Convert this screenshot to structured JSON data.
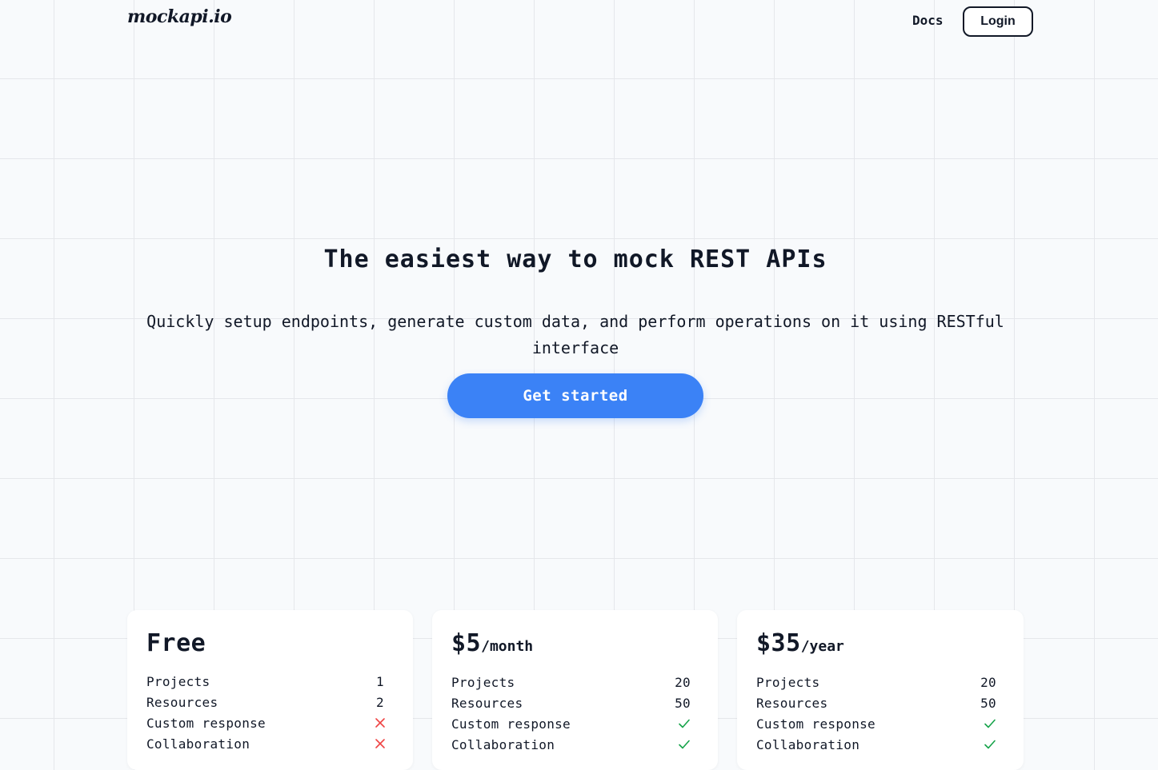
{
  "header": {
    "logo": "mockapi.io",
    "nav": {
      "docs_label": "Docs",
      "login_label": "Login"
    }
  },
  "hero": {
    "title": "The easiest way to mock REST APIs",
    "subtitle": "Quickly setup endpoints, generate custom data, and perform operations on it using RESTful interface",
    "cta_label": "Get started"
  },
  "pricing": {
    "plans": [
      {
        "price": "Free",
        "period": "",
        "features": [
          {
            "label": "Projects",
            "value": "1"
          },
          {
            "label": "Resources",
            "value": "2"
          },
          {
            "label": "Custom response",
            "icon": "x-icon"
          },
          {
            "label": "Collaboration",
            "icon": "x-icon"
          }
        ]
      },
      {
        "price": "$5",
        "period": "/month",
        "features": [
          {
            "label": "Projects",
            "value": "20"
          },
          {
            "label": "Resources",
            "value": "50"
          },
          {
            "label": "Custom response",
            "icon": "check-icon"
          },
          {
            "label": "Collaboration",
            "icon": "check-icon"
          }
        ]
      },
      {
        "price": "$35",
        "period": "/year",
        "features": [
          {
            "label": "Projects",
            "value": "20"
          },
          {
            "label": "Resources",
            "value": "50"
          },
          {
            "label": "Custom response",
            "icon": "check-icon"
          },
          {
            "label": "Collaboration",
            "icon": "check-icon"
          }
        ]
      }
    ]
  },
  "colors": {
    "accent": "#3b82f6",
    "check": "#16a34a",
    "cross": "#ef4444",
    "text": "#111827",
    "background": "#f8fafc",
    "grid": "#e5e7eb"
  }
}
